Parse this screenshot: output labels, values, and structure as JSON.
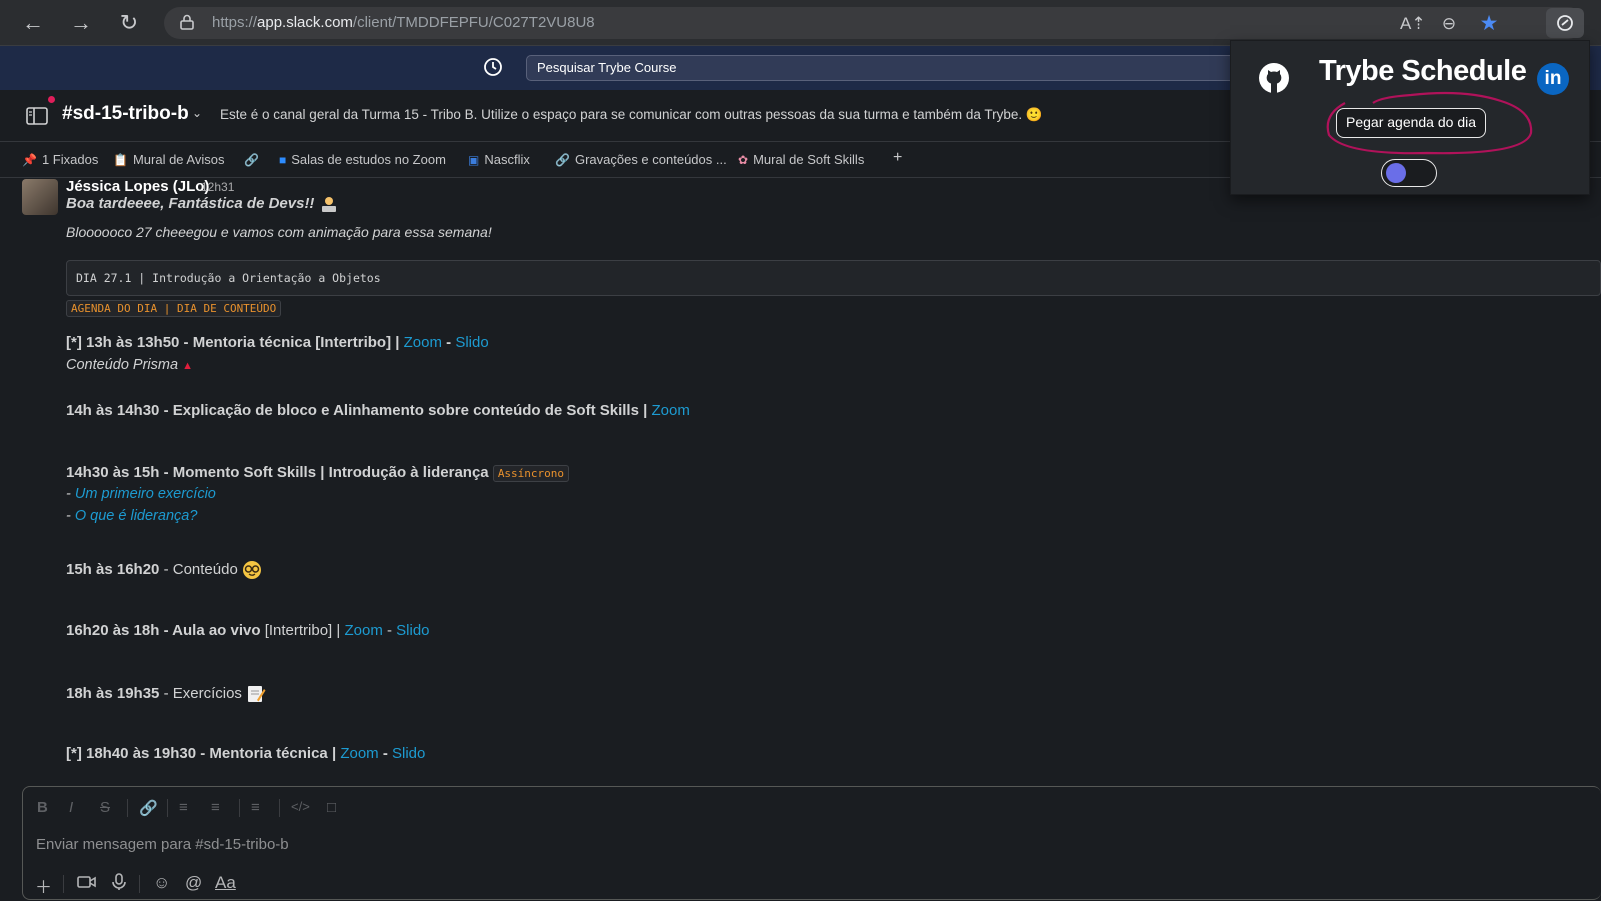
{
  "browser": {
    "url_prefix": "https://",
    "url_host": "app.slack.com",
    "url_path": "/client/TMDDFEPFU/C027T2VU8U8"
  },
  "slack_top": {
    "search_placeholder": "Pesquisar Trybe Course"
  },
  "channel": {
    "name": "#sd-15-tribo-b",
    "topic": "Este é o canal geral da Turma 15 - Tribo B. Utilize o espaço para se comunicar com outras pessoas da sua turma e também da Trybe. 🙂"
  },
  "bookmarks": [
    {
      "icon": "pin-icon",
      "label": "1 Fixados"
    },
    {
      "icon": "board-icon",
      "label": "Mural de Avisos"
    },
    {
      "icon": "link-icon",
      "label": ""
    },
    {
      "icon": "zoom-icon",
      "label": "Salas de estudos no Zoom"
    },
    {
      "icon": "tv-icon",
      "label": "Nascflix"
    },
    {
      "icon": "link-icon",
      "label": "Gravações e conteúdos ..."
    },
    {
      "icon": "brain-icon",
      "label": "Mural de Soft Skills"
    },
    {
      "icon": "plus-icon",
      "label": "+"
    }
  ],
  "message": {
    "author": "Jéssica Lopes (JLo)",
    "time": "12h31",
    "greeting": "Boa tardeeee, Fantástica de Devs!!",
    "intro": "Bloooooco 27 cheeegou e vamos com animação para essa semana!",
    "code_block": "DIA 27.1 | Introdução a Orientação a Objetos",
    "agenda_tag": "AGENDA DO DIA | DIA DE CONTEÚDO",
    "items": {
      "i1_text": "[*] 13h às 13h50 - Mentoria técnica [Intertribo] | ",
      "i1_zoom": "Zoom",
      "i1_sep": " - ",
      "i1_slido": "Slido",
      "i1_sub": "Conteúdo Prisma",
      "i2_text": "14h às 14h30 - Explicação de bloco e Alinhamento sobre conteúdo de Soft Skills | ",
      "i2_zoom": "Zoom",
      "i3_text": "14h30 às 15h - Momento Soft Skills | Introdução à liderança ",
      "i3_tag": "Assíncrono",
      "i3_dash1": "- ",
      "i3_link1": "Um primeiro exercício",
      "i3_dash2": "- ",
      "i3_link2": "O que é liderança?",
      "i4_bold": "15h às 16h20",
      "i4_rest": " - Conteúdo",
      "i5_bold": "16h20 às 18h - Aula ao vivo",
      "i5_rest": " [Intertribo]  | ",
      "i5_zoom": "Zoom",
      "i5_sep": " - ",
      "i5_slido": "Slido",
      "i6_bold": "18h às 19h35",
      "i6_rest": " - Exercícios",
      "i7_text": "[*] 18h40 às 19h30 - Mentoria técnica | ",
      "i7_zoom": "Zoom",
      "i7_sep": " - ",
      "i7_slido": "Slido"
    }
  },
  "composer": {
    "placeholder": "Enviar mensagem para #sd-15-tribo-b",
    "format_buttons": [
      "B",
      "I",
      "S"
    ],
    "text_format_label": "Aa"
  },
  "popup": {
    "title": "Trybe Schedule",
    "button_label": "Pegar agenda do dia",
    "linkedin_label": "in",
    "annotation_color": "#b0125a",
    "toggle_color": "#6a6ee8"
  }
}
